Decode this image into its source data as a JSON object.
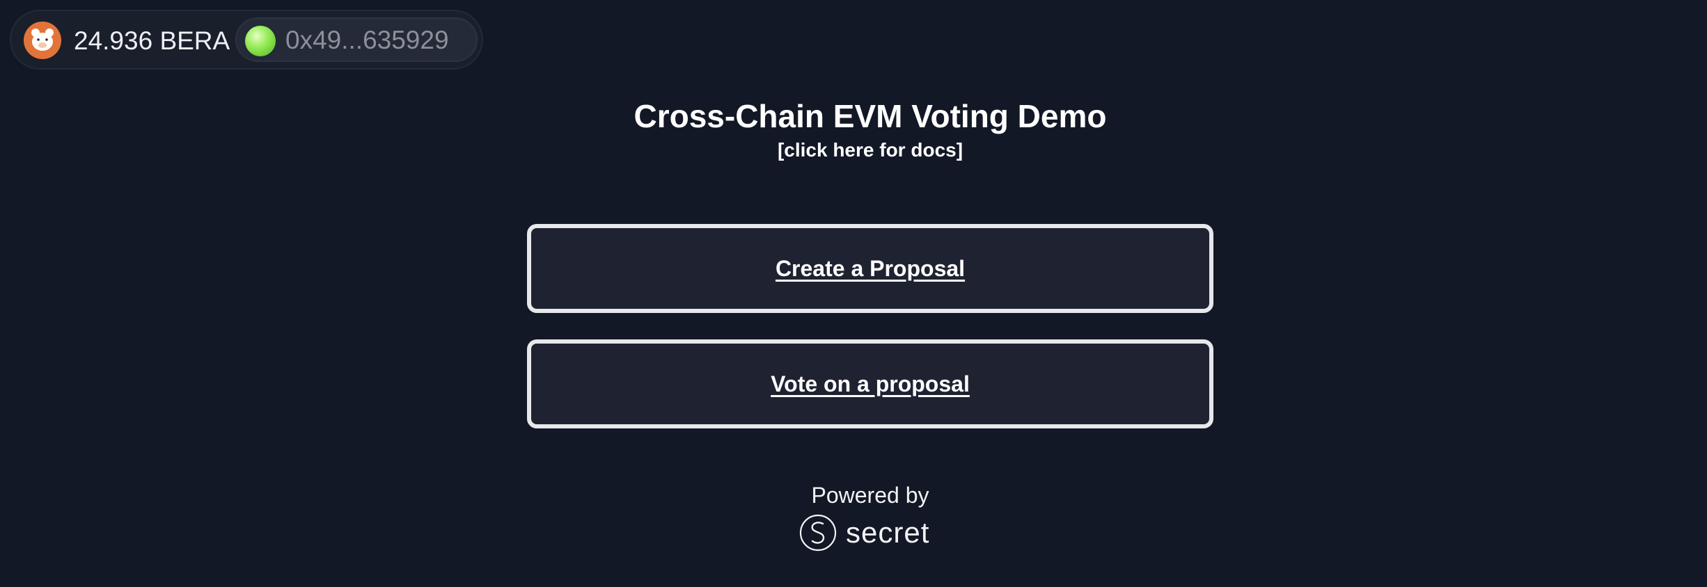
{
  "wallet": {
    "network_icon": "bera-bear-icon",
    "balance": "24.936 BERA",
    "account_avatar_icon": "account-avatar-green-orb",
    "address": "0x49...635929"
  },
  "header": {
    "title": "Cross-Chain EVM Voting Demo",
    "docs_link": "[click here for docs]"
  },
  "actions": {
    "create_label": "Create a Proposal",
    "vote_label": "Vote on a proposal"
  },
  "footer": {
    "powered_by": "Powered by",
    "brand_icon": "secret-logo-icon",
    "brand_name": "secret"
  },
  "colors": {
    "background": "#131826",
    "card_background": "#1f2331",
    "card_border": "#e6e8ec",
    "network_badge": "#e2743a",
    "avatar_green": "#97ec5a",
    "address_text": "#8b909b"
  }
}
